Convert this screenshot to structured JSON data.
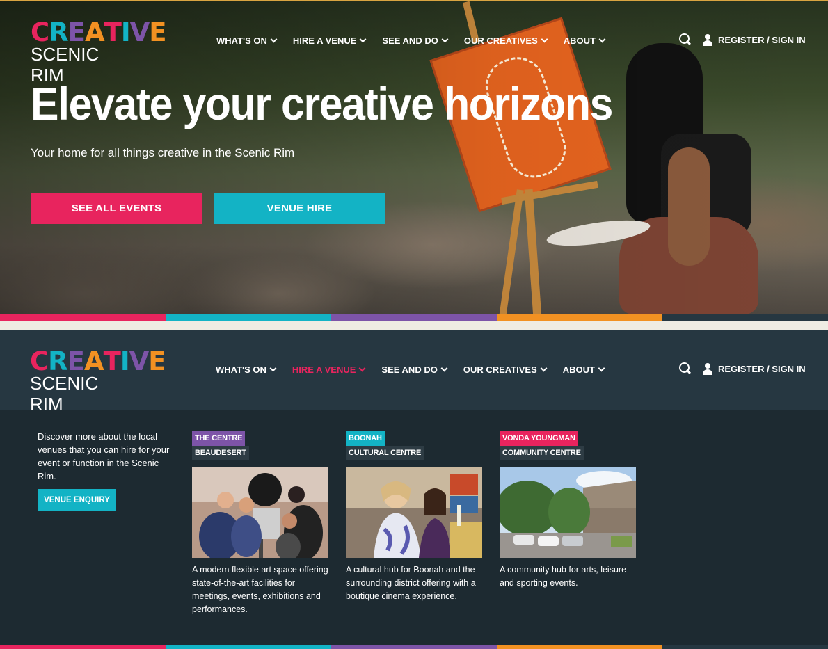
{
  "brand": {
    "logo_word": [
      "C",
      "R",
      "E",
      "A",
      "T",
      "I",
      "V",
      "E"
    ],
    "logo_colors": [
      "#e8245e",
      "#13b3c5",
      "#7d54a8",
      "#f29122",
      "#e8245e",
      "#13b3c5",
      "#7d54a8",
      "#f29122"
    ],
    "logo_sub": "SCENIC RIM"
  },
  "nav": {
    "items": [
      {
        "label": "WHAT'S ON"
      },
      {
        "label": "HIRE A VENUE"
      },
      {
        "label": "SEE AND DO"
      },
      {
        "label": "OUR CREATIVES"
      },
      {
        "label": "ABOUT"
      }
    ],
    "register_label": "REGISTER / SIGN IN",
    "active_color": "#e8245e"
  },
  "hero": {
    "title": "Elevate your creative horizons",
    "subtitle": "Your home for all things creative in the Scenic Rim",
    "btn_events": "SEE ALL EVENTS",
    "btn_venue": "VENUE HIRE"
  },
  "stripe_colors": [
    "#e8245e",
    "#13b3c5",
    "#7d54a8",
    "#f29122",
    "#263741"
  ],
  "mega_menu": {
    "intro": "Discover more about the local venues that you can hire for your event or function in the Scenic Rim.",
    "enquiry_label": "VENUE ENQUIRY",
    "venues": [
      {
        "tag1": "THE CENTRE",
        "tag2": "BEAUDESERT",
        "tag_color": "#7d54a8",
        "desc": "A modern flexible art space offering state-of-the-art facilities for meetings, events, exhibitions and performances."
      },
      {
        "tag1": "BOONAH",
        "tag2": "CULTURAL CENTRE",
        "tag_color": "#13b3c5",
        "desc": "A cultural hub for Boonah and the surrounding district offering with a boutique cinema experience."
      },
      {
        "tag1": "VONDA YOUNGMAN",
        "tag2": "COMMUNITY CENTRE",
        "tag_color": "#e8245e",
        "desc": "A community hub for arts, leisure and sporting events."
      }
    ]
  }
}
